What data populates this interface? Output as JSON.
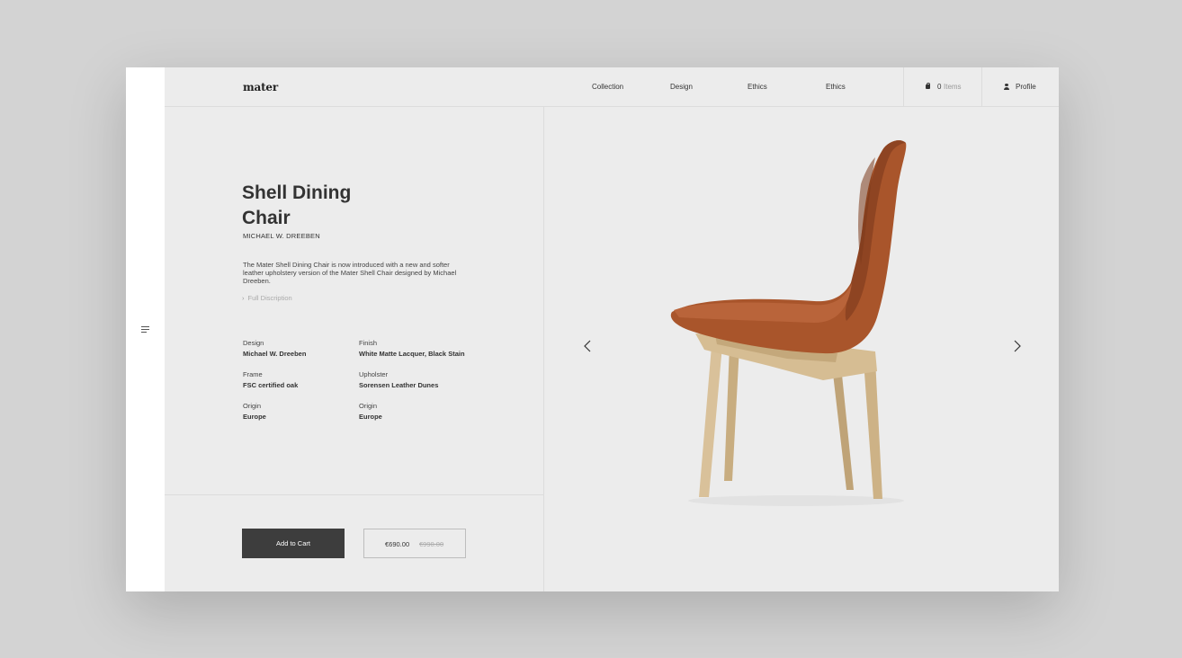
{
  "brand": {
    "logo": "mater"
  },
  "nav": {
    "links": [
      "Collection",
      "Design",
      "Ethics",
      "Ethics"
    ],
    "cart": {
      "count": "0",
      "label": "Items"
    },
    "profile": "Profile"
  },
  "product": {
    "title_line1": "Shell Dining",
    "title_line2": "Chair",
    "designer": "MICHAEL W. DREEBEN",
    "description": "The Mater Shell Dining Chair is now introduced with a new and softer leather upholstery version of the Mater Shell Chair designed by Michael Dreeben.",
    "full_description_link": "Full Discription",
    "specs": [
      {
        "label": "Design",
        "value": "Michael W. Dreeben"
      },
      {
        "label": "Finish",
        "value": "White Matte Lacquer, Black Stain"
      },
      {
        "label": "Frame",
        "value": "FSC certified oak"
      },
      {
        "label": "Upholster",
        "value": "Sorensen Leather Dunes"
      },
      {
        "label": "Origin",
        "value": "Europe"
      },
      {
        "label": "Origin",
        "value": "Europe"
      }
    ],
    "add_to_cart": "Add to Cart",
    "price": "€690.00",
    "old_price": "€990.00"
  },
  "colors": {
    "page_bg": "#d3d3d3",
    "panel_bg": "#ececec",
    "button_bg": "#3d3d3d",
    "leather": "#a9552b",
    "oak": "#d6bd93"
  },
  "icons": {
    "menu": "hamburger-menu-icon",
    "cart": "shopping-bag-icon",
    "profile": "user-icon",
    "prev": "chevron-left-icon",
    "next": "chevron-right-icon"
  }
}
